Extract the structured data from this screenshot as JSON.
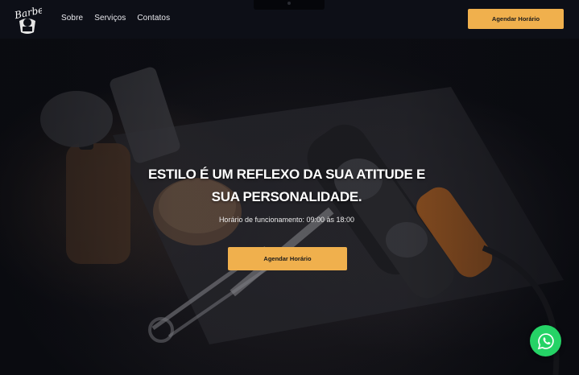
{
  "header": {
    "logo_text": "Barber",
    "nav": [
      {
        "label": "Sobre"
      },
      {
        "label": "Serviços"
      },
      {
        "label": "Contatos"
      }
    ],
    "cta_label": "Agendar Horário"
  },
  "hero": {
    "title_line1": "ESTILO É UM REFLEXO DA SUA ATITUDE E",
    "title_line2": "SUA PERSONALIDADE.",
    "subtitle": "Horário de funcionamento: 09:00 às 18:00",
    "cta_label": "Agendar Horário",
    "background_image": "barber-tools-photo"
  },
  "floating": {
    "icon": "whatsapp-icon"
  },
  "colors": {
    "accent": "#f0b04d",
    "header_bg": "#0d0f17",
    "whatsapp": "#25d366",
    "text_light": "#ffffff"
  }
}
